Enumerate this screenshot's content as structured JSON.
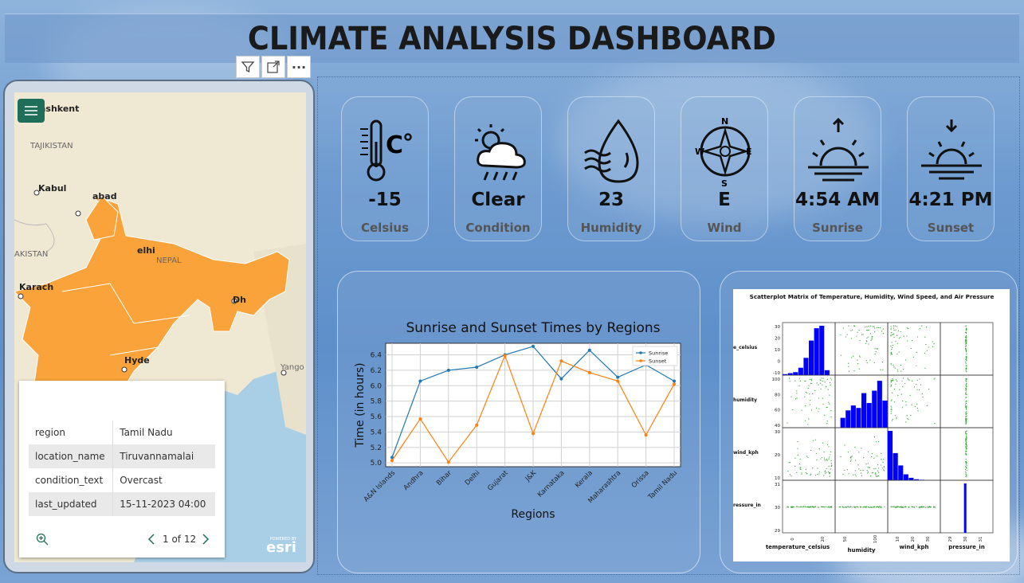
{
  "title": "CLIMATE ANALYSIS DASHBOARD",
  "toolbar": {
    "filter_icon": "filter-icon",
    "focus_icon": "focus-mode-icon",
    "more_label": "···"
  },
  "map": {
    "labels": [
      "ashkent",
      "TAJIKISTAN",
      "Kabul",
      "abad",
      "AKISTAN",
      "elhi",
      "NEPAL",
      "Karach",
      "Dh",
      "Hyde",
      "Yango"
    ],
    "attribution": "esri",
    "attribution_small": "POWERED BY",
    "popup": {
      "rows": [
        {
          "field": "region",
          "value": "Tamil Nadu"
        },
        {
          "field": "location_name",
          "value": "Tiruvannamalai"
        },
        {
          "field": "condition_text",
          "value": "Overcast"
        },
        {
          "field": "last_updated",
          "value": "15-11-2023 04:00"
        }
      ],
      "pager": "1 of 12"
    },
    "region_color": "#f9a33a"
  },
  "stats": [
    {
      "value": "-15",
      "label": "Celsius",
      "icon": "thermometer-icon"
    },
    {
      "value": "Clear",
      "label": "Condition",
      "icon": "cloud-rain-sun-icon"
    },
    {
      "value": "23",
      "label": "Humidity",
      "icon": "water-drop-icon"
    },
    {
      "value": "E",
      "label": "Wind",
      "icon": "compass-icon"
    },
    {
      "value": "4:54 AM",
      "label": "Sunrise",
      "icon": "sunrise-icon"
    },
    {
      "value": "4:21 PM",
      "label": "Sunset",
      "icon": "sunset-icon"
    }
  ],
  "chart_data": [
    {
      "type": "line",
      "title": "Sunrise and Sunset Times by Regions",
      "xlabel": "Regions",
      "ylabel": "Time (in hours)",
      "categories": [
        "A&N Islands",
        "Andhra",
        "Bihar",
        "Delhi",
        "Gujarat",
        "J&K",
        "Karnataka",
        "Kerala",
        "Maharashtra",
        "Orissa",
        "Tamil Nadu"
      ],
      "ylim": [
        4.95,
        6.55
      ],
      "yticks": [
        "5.0",
        "5.2",
        "5.4",
        "5.6",
        "5.8",
        "6.0",
        "6.2",
        "6.4"
      ],
      "grid": true,
      "legend": "top-right",
      "series": [
        {
          "name": "Sunrise",
          "color": "#1f77b4",
          "values": [
            5.07,
            6.06,
            6.2,
            6.24,
            6.4,
            6.51,
            6.09,
            6.46,
            6.11,
            6.27,
            6.06
          ]
        },
        {
          "name": "Sunset",
          "color": "#ff7f0e",
          "values": [
            5.03,
            5.57,
            5.01,
            5.49,
            6.39,
            5.38,
            6.32,
            6.17,
            6.06,
            5.36,
            6.02
          ]
        }
      ]
    },
    {
      "type": "scatter",
      "title": "Scatterplot Matrix of Temperature, Humidity, Wind Speed, and Air Pressure",
      "variables": [
        "temperature_celsius",
        "humidity",
        "wind_kph",
        "pressure_in"
      ],
      "row_labels": [
        "e_celsius",
        "humidity",
        "wind_kph",
        "ressure_in"
      ],
      "hist_color": "#0000ff",
      "point_color": "#2ca02c",
      "yticks": {
        "temperature_celsius": [
          "30",
          "20",
          "10",
          "0",
          "-10"
        ],
        "humidity": [
          "100",
          "80",
          "60",
          "40"
        ],
        "wind_kph": [
          "30",
          "20",
          "10"
        ],
        "pressure_in": [
          "31",
          "30",
          "29"
        ]
      },
      "xticks": {
        "temperature_celsius": [
          "0",
          "20"
        ],
        "humidity": [
          "50",
          "100"
        ],
        "wind_kph": [
          "10",
          "20",
          "30"
        ],
        "pressure_in": [
          "29",
          "30",
          "31"
        ]
      }
    }
  ]
}
